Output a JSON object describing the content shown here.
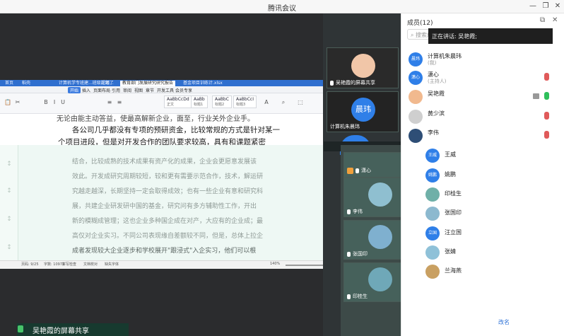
{
  "app": {
    "title": "腾讯会议"
  },
  "window_buttons": {
    "minimize": "—",
    "restore": "❐",
    "close": "✕"
  },
  "doc": {
    "tabs": [
      "首页",
      "稻壳",
      "计算机学专班建...班级计划了",
      "超级...",
      "教育部门发展研究研究报告",
      "基金项目训练计.xlsx"
    ],
    "menu": [
      "开始",
      "插入",
      "页面布局",
      "引用",
      "审阅",
      "视图",
      "章节",
      "开发工具",
      "会员专享"
    ],
    "styles": [
      {
        "sample": "AaBbCcDd",
        "caption": "正文"
      },
      {
        "sample": "AaBb",
        "caption": "标题1"
      },
      {
        "sample": "AaBbC",
        "caption": "标题2"
      },
      {
        "sample": "AaBbCcI",
        "caption": "标题3"
      }
    ],
    "top_lines": [
      "无论由能主动答益，使最高解新企业，面至，行业关外企业手。",
      "各公司几乎都没有专项的预研资金，比较常规的方式是针对某一",
      "个项目进段，但是对开发合作的团队要求较高，具有和课题紧密"
    ],
    "bottom_lines": [
      "结合，比较成熟的技术成果有资产化的成果，企业会更愿意发展该",
      "效此。开发成研究周期较短，较和更有需要示范合作，技术，解运研",
      "究越走越深，长期坚持一定会取得成效；也有一些企业有意和研究科",
      "展，共建企业研发研中国的基金，研究问有多方辅助性工作，开出",
      "新的模糊成管理；这也企业多种国企成在对产，大应有的企业成；最",
      "高仅对企业实习。不同公司表现缘自差额较不同，但是，总体上拉企",
      "成者发现较大企业逐步和学校展开\"跟浸式\"入企实习，他们可以根"
    ],
    "status": [
      "页码: 9/25",
      "字数: 10971",
      "拼写检查",
      "文档校对",
      "缺失字体"
    ],
    "zoom": "140%"
  },
  "share_banner": "吴艳霞的屏幕共享",
  "tiles": [
    {
      "name": "吴艳霞的屏幕共享",
      "avatar_color": "#f1c6a8",
      "kind": "photo"
    },
    {
      "name": "计算机朱晨玮",
      "avatar_text": "晨玮",
      "avatar_color": "#2f7fe8",
      "kind": "text"
    },
    {
      "name": "潇心",
      "avatar_text": "潇心",
      "avatar_color": "#2f7fe8",
      "kind": "text"
    },
    {
      "name": "李伟",
      "avatar_color": "#8fbfd0",
      "kind": "photo"
    },
    {
      "name": "张国印",
      "avatar_color": "#7fb0cf",
      "kind": "photo"
    },
    {
      "name": "印桂生",
      "avatar_color": "#6fa8b8",
      "kind": "photo"
    }
  ],
  "panel": {
    "title": "成员(12)",
    "search_placeholder": "搜索成员",
    "speaking_tip": "正在讲话: 吴艳霞;",
    "members_top": [
      {
        "name": "计算机朱晨玮",
        "sub": "(我)",
        "avatar_text": "晨玮",
        "avatar_color": "#2f7fe8",
        "mic": "#2fbf5b"
      },
      {
        "name": "潇心",
        "sub": "(主持人)",
        "avatar_text": "潇心",
        "avatar_color": "#2f7fe8",
        "mic": "#e05a5a"
      },
      {
        "name": "吴艳霞",
        "sub": "",
        "avatar_text": "",
        "avatar_color": "#f1b98e",
        "mic": "#2fbf5b"
      },
      {
        "name": "黄少滨",
        "sub": "",
        "avatar_text": "",
        "avatar_color": "#cfcfcf",
        "mic": "#e05a5a"
      },
      {
        "name": "李伟",
        "sub": "",
        "avatar_text": "",
        "avatar_color": "#2e4e76",
        "mic": "#e05a5a"
      }
    ],
    "members_lower": [
      {
        "name": "王威",
        "avatar_text": "王威",
        "avatar_color": "#2f7fe8"
      },
      {
        "name": "姚鹏",
        "avatar_text": "姚鹏",
        "avatar_color": "#2f7fe8"
      },
      {
        "name": "印桂生",
        "avatar_text": "",
        "avatar_color": "#6fb0a8"
      },
      {
        "name": "张国印",
        "avatar_text": "",
        "avatar_color": "#8cb9cf"
      },
      {
        "name": "汪立国",
        "avatar_text": "立国",
        "avatar_color": "#2f7fe8"
      },
      {
        "name": "张婧",
        "avatar_text": "",
        "avatar_color": "#8fc1d8"
      },
      {
        "name": "兰海燕",
        "avatar_text": "",
        "avatar_color": "#c9a062"
      }
    ],
    "edit_name": "改名"
  }
}
